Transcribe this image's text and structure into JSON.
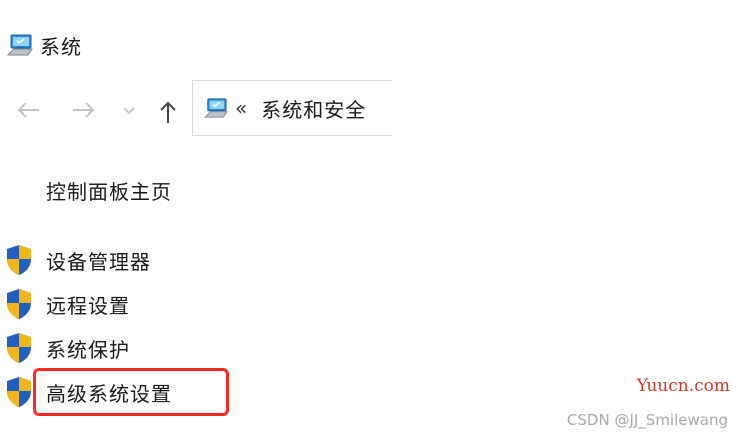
{
  "window": {
    "title": "系统"
  },
  "nav": {
    "back_icon": "arrow-left-icon",
    "forward_icon": "arrow-right-icon",
    "recent_icon": "chevron-down-icon",
    "up_icon": "arrow-up-icon"
  },
  "address_bar": {
    "icon": "control-panel-icon",
    "overflow": "«",
    "path": "系统和安全"
  },
  "sidebar": {
    "home_link": "控制面板主页",
    "tasks": [
      {
        "label": "设备管理器",
        "icon": "uac-shield-icon"
      },
      {
        "label": "远程设置",
        "icon": "uac-shield-icon"
      },
      {
        "label": "系统保护",
        "icon": "uac-shield-icon"
      },
      {
        "label": "高级系统设置",
        "icon": "uac-shield-icon",
        "highlighted": true
      }
    ]
  },
  "colors": {
    "highlight_border": "#ff2a1f",
    "shield_blue": "#1f5fbf",
    "shield_gold": "#f2b61c",
    "watermark_red": "#d23a2a",
    "watermark_gray": "#a8a8a8"
  },
  "watermarks": {
    "site": "Yuucn.com",
    "author": "CSDN @JJ_Smilewang"
  }
}
